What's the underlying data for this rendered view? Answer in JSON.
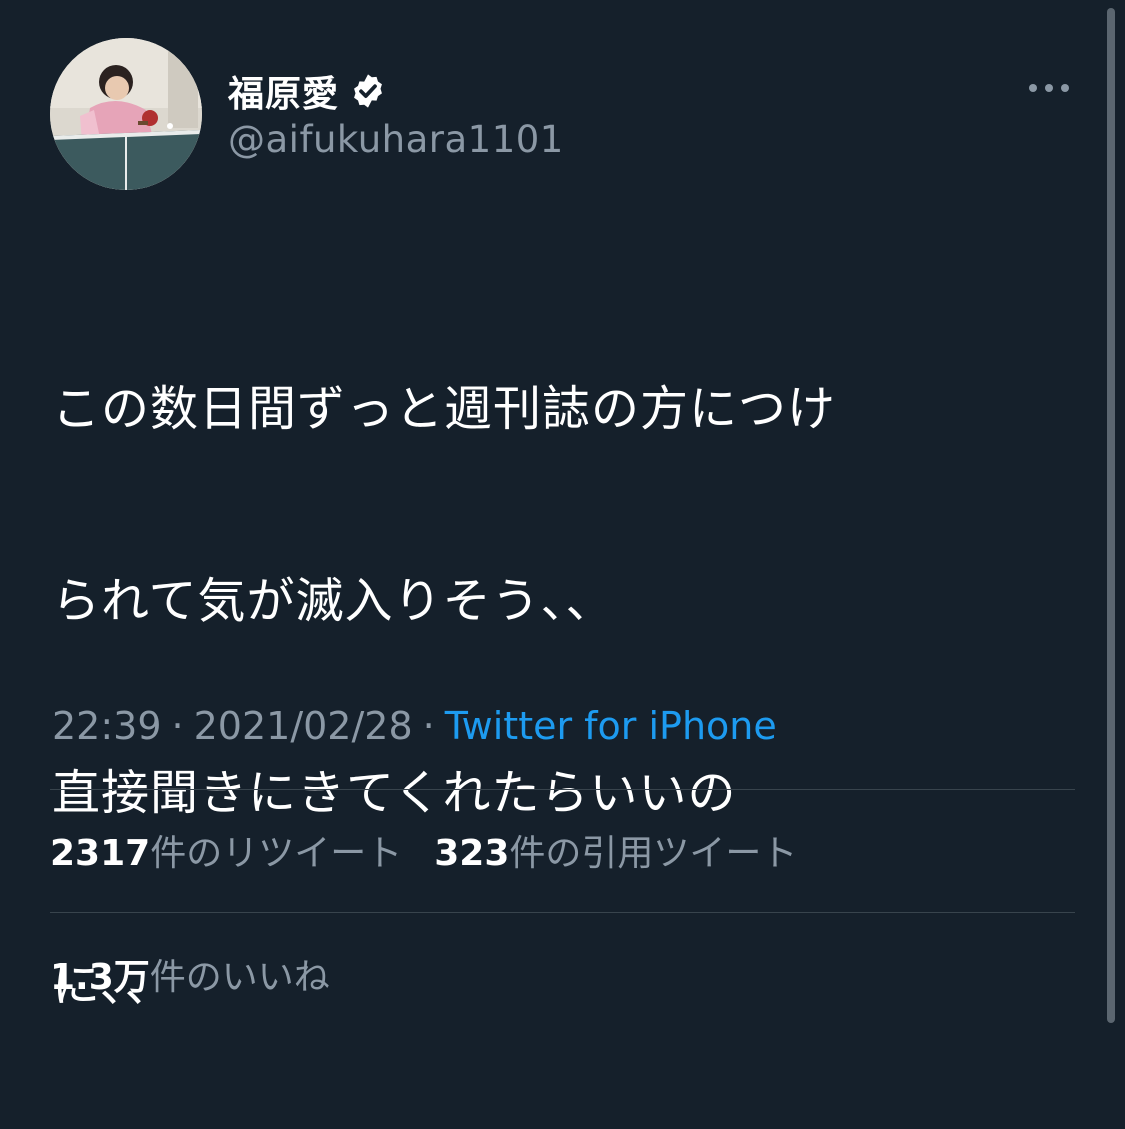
{
  "colors": {
    "background": "#15202b",
    "primary_text": "#ffffff",
    "secondary_text": "#8b98a5",
    "link": "#1d9bf0",
    "divider": "#38444d"
  },
  "author": {
    "display_name": "福原愛",
    "handle": "@aifukuhara1101",
    "verified": true,
    "avatar_icon": "profile-photo"
  },
  "tweet": {
    "text_lines": [
      "この数日間ずっと週刊誌の方につけ",
      "られて気が滅入りそう、、",
      "直接聞きにきてくれたらいいの",
      "に、、"
    ],
    "time": "22:39",
    "date": "2021/02/28",
    "separator": "·",
    "source": "Twitter for iPhone"
  },
  "stats": {
    "retweets_value": "2317",
    "retweets_label": "件のリツイート",
    "quotes_value": "323",
    "quotes_label": "件の引用ツイート",
    "likes_value": "1.3万",
    "likes_label": "件のいいね"
  },
  "icons": {
    "more": "more-horizontal-icon",
    "verified": "verified-badge-icon"
  }
}
